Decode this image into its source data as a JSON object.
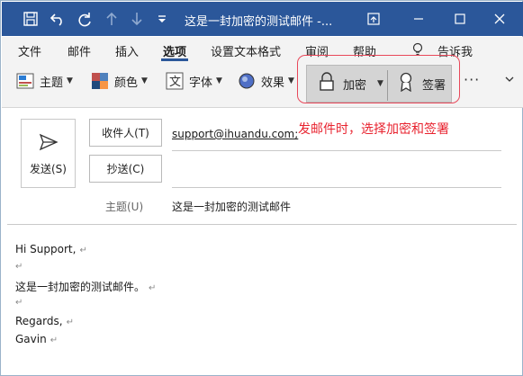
{
  "window": {
    "title": "这是一封加密的测试邮件 -...",
    "colors": {
      "titlebar": "#2b579a",
      "accent_red": "#e8232f"
    }
  },
  "quick_access": {
    "icons": [
      "save-icon",
      "undo-icon",
      "redo-icon",
      "up-arrow-icon",
      "down-arrow-icon",
      "customize-dropdown-icon"
    ]
  },
  "ribbon_tabs": [
    {
      "label": "文件"
    },
    {
      "label": "邮件"
    },
    {
      "label": "插入"
    },
    {
      "label": "选项",
      "active": true
    },
    {
      "label": "设置文本格式"
    },
    {
      "label": "审阅"
    },
    {
      "label": "帮助"
    },
    {
      "label": "告诉我"
    }
  ],
  "ribbon": {
    "theme_label": "主题",
    "colors_label": "颜色",
    "fonts_label": "字体",
    "effects_label": "效果",
    "encrypt_label": "加密",
    "sign_label": "签署",
    "more_label": "···"
  },
  "compose": {
    "send_label": "发送(S)",
    "to_button": "收件人(T)",
    "cc_button": "抄送(C)",
    "to_value": "support@ihuandu.com;",
    "subject_label": "主题(U)",
    "subject_value": "这是一封加密的测试邮件"
  },
  "annotation": "发邮件时，选择加密和签署",
  "body": {
    "greeting": "Hi Support,",
    "line1": "这是一封加密的测试邮件。",
    "regards": "Regards,",
    "name": "Gavin",
    "para_mark": "↵"
  }
}
